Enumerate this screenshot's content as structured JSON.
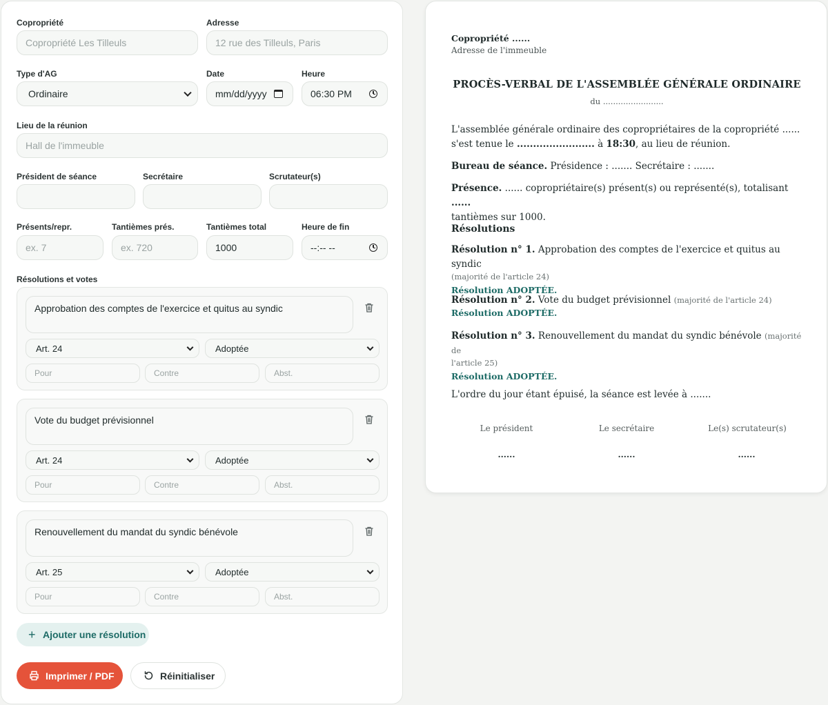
{
  "form": {
    "copropriete_label": "Copropriété",
    "copropriete_placeholder": "Copropriété Les Tilleuls",
    "adresse_label": "Adresse",
    "adresse_placeholder": "12 rue des Tilleuls, Paris",
    "type_ag_label": "Type d'AG",
    "type_ag_value": "Ordinaire",
    "date_label": "Date",
    "date_value": "mm/dd/yyyy",
    "heure_label": "Heure",
    "heure_value": "06:30 PM",
    "lieu_label": "Lieu de la réunion",
    "lieu_placeholder": "Hall de l'immeuble",
    "president_label": "Président de séance",
    "secretaire_label": "Secrétaire",
    "scrutateurs_label": "Scrutateur(s)",
    "presents_label": "Présents/repr.",
    "presents_placeholder": "ex. 7",
    "tantiemes_pres_label": "Tantièmes prés.",
    "tantiemes_pres_placeholder": "ex. 720",
    "tantiemes_total_label": "Tantièmes total",
    "tantiemes_total_value": "1000",
    "heure_fin_label": "Heure de fin",
    "heure_fin_value": "--:-- --",
    "resolutions_label": "Résolutions et votes",
    "pour_placeholder": "Pour",
    "contre_placeholder": "Contre",
    "abst_placeholder": "Abst.",
    "resolutions": [
      {
        "title": "Approbation des comptes de l'exercice et quitus au syndic",
        "article": "Art. 24",
        "status": "Adoptée"
      },
      {
        "title": "Vote du budget prévisionnel",
        "article": "Art. 24",
        "status": "Adoptée"
      },
      {
        "title": "Renouvellement du mandat du syndic bénévole",
        "article": "Art. 25",
        "status": "Adoptée"
      }
    ],
    "add_resolution_label": "Ajouter une résolution",
    "print_label": "Imprimer / PDF",
    "reset_label": "Réinitialiser"
  },
  "preview": {
    "copro_heading": "Copropriété ......",
    "address_line": "Adresse de l'immeuble",
    "title": "PROCÈS-VERBAL DE L'ASSEMBLÉE GÉNÉRALE ORDINAIRE",
    "du_line": "du ........................",
    "intro_1": "L'assemblée générale ordinaire des copropriétaires de la copropriété ......",
    "intro_2a": "s'est tenue le ",
    "intro_2_date": "........................",
    "intro_2b": " à ",
    "intro_2_time": "18:30",
    "intro_2c": ", au lieu de réunion.",
    "bureau_bold": "Bureau de séance.",
    "bureau_text": " Présidence : ....... Secrétaire : .......",
    "presence_bold": "Présence.",
    "presence_text": " ...... copropriétaire(s) présent(s) ou représenté(s), totalisant ",
    "presence_dots": "......",
    "presence_line2": "tantièmes sur 1000.",
    "resolutions_heading": "Résolutions",
    "res1_num": "Résolution n° 1.",
    "res1_title": " Approbation des comptes de l'exercice et quitus au syndic",
    "res1_maj": "(majorité de l'article 24)",
    "res1_status": "Résolution ADOPTÉE.",
    "res2_num": "Résolution n° 2.",
    "res2_title": " Vote du budget prévisionnel ",
    "res2_maj": "(majorité de l'article 24)",
    "res2_status": "Résolution ADOPTÉE.",
    "res3_num": "Résolution n° 3.",
    "res3_title": " Renouvellement du mandat du syndic bénévole ",
    "res3_maj_a": "(majorité de",
    "res3_maj_b": "l'article 25)",
    "res3_status": "Résolution ADOPTÉE.",
    "closing": "L'ordre du jour étant épuisé, la séance est levée à .......",
    "sig_president": "Le président",
    "sig_secretaire": "Le secrétaire",
    "sig_scrutateurs": "Le(s) scrutateur(s)",
    "sig_dots": "......"
  },
  "colors": {
    "accent": "#e5533a",
    "teal": "#1d6b66",
    "add_bg": "#e4f1ef"
  }
}
